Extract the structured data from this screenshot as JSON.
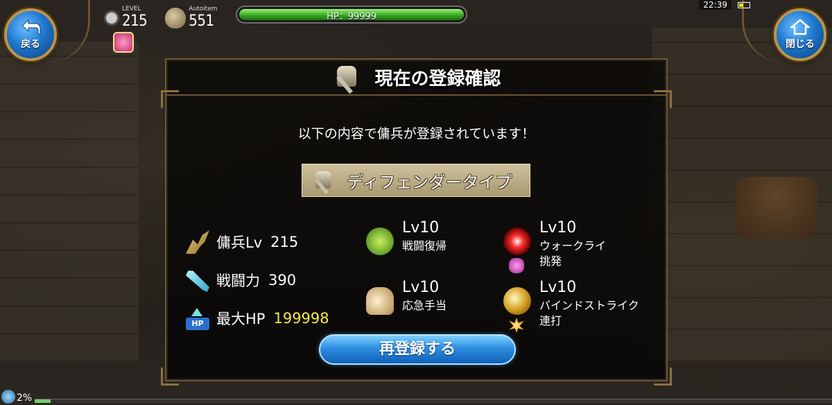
{
  "hud": {
    "level_label": "LEVEL",
    "level_value": "215",
    "autoitem_label": "Autoitem",
    "autoitem_value": "551",
    "hp_text": "HP：99999",
    "hp_fraction": 1.0,
    "clock": "22:39",
    "exp_text": "2%",
    "exp_fraction": 0.02
  },
  "buttons": {
    "back_label": "戻る",
    "close_label": "閉じる",
    "reregister_label": "再登録する"
  },
  "panel": {
    "title": "現在の登録確認",
    "message": "以下の内容で傭兵が登録されています！",
    "type_label": "ディフェンダータイプ"
  },
  "stats": [
    {
      "label": "傭兵Lv",
      "value": "215",
      "icon": "mercenary-icon"
    },
    {
      "label": "戦闘力",
      "value": "390",
      "icon": "sword-icon"
    },
    {
      "label": "最大HP",
      "value": "199998",
      "icon": "hp-up-icon"
    }
  ],
  "skills_mid": [
    {
      "level": "Lv10",
      "name": "戦闘復帰",
      "icon": "return-icon"
    },
    {
      "level": "Lv10",
      "name": "応急手当",
      "icon": "first-aid-icon"
    }
  ],
  "skills_right": [
    {
      "level": "Lv10",
      "name": "ウォークライ",
      "sub": "挑発",
      "icon": "war-cry-icon"
    },
    {
      "level": "Lv10",
      "name": "バインドストライク",
      "sub": "連打",
      "icon": "bind-strike-icon"
    }
  ],
  "colors": {
    "accent_blue": "#2d8ee0",
    "hp_green": "#33a31f",
    "hp_highlight": "#f5e94a",
    "panel_border": "#6a5636"
  }
}
